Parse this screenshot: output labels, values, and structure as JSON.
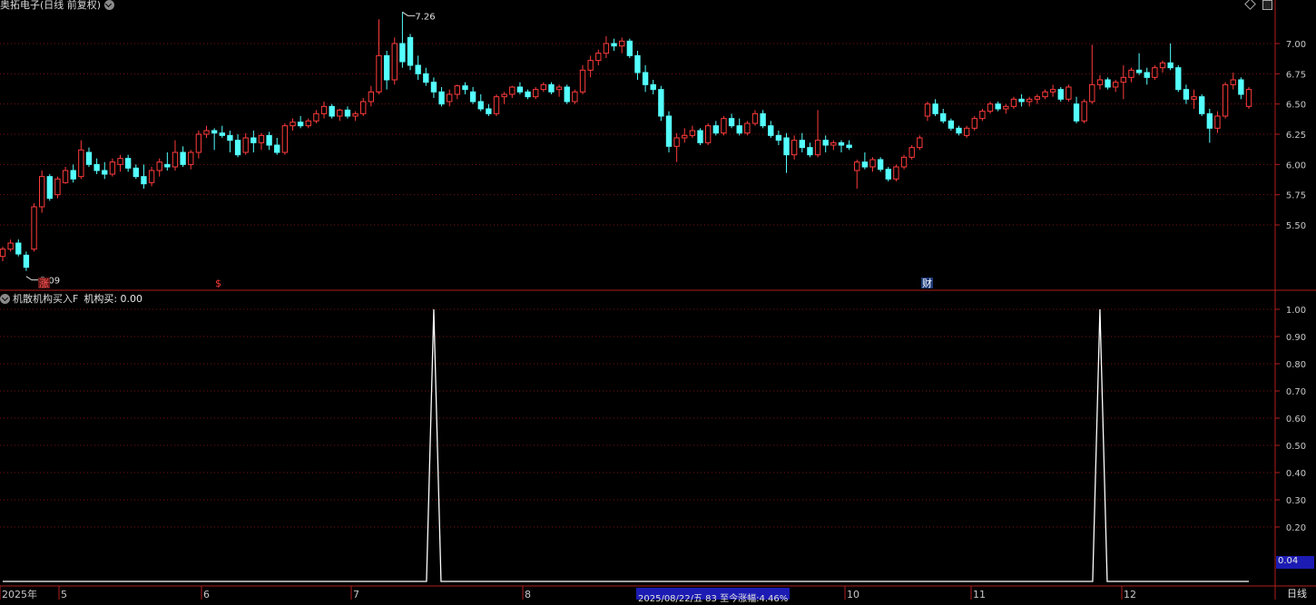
{
  "header": {
    "stock_title": "奥拓电子(日线 前复权)",
    "window_icons": [
      "diamond-icon",
      "scroll-up-icon"
    ]
  },
  "colors": {
    "up": "#ff3b3b",
    "down": "#54ffff",
    "frame": "#b01e1e",
    "grid": "#7a1212",
    "tick_text": "#c8c8c8",
    "indicator_line": "#ffffff",
    "highlight_bg": "#1c1cb4"
  },
  "price_chart": {
    "high_marker": "7.26",
    "low_marker": "5.09",
    "event_markers": [
      "涨",
      "$",
      "财"
    ]
  },
  "indicator": {
    "name": "机散机构买入F",
    "label": "机构买: 0.00",
    "current_value_box": "0.04"
  },
  "bottom_bar": {
    "status_text": "2025/08/22/五 83 至今涨幅:4.46%",
    "period_label": "日线",
    "month_labels": [
      "2025年",
      "5",
      "6",
      "7",
      "8",
      "10",
      "11",
      "12"
    ]
  },
  "chart_data": [
    {
      "type": "candlestick",
      "title": "奥拓电子(日线 前复权)",
      "y_ticks": [
        "7.00",
        "6.75",
        "6.50",
        "6.25",
        "6.00",
        "5.75",
        "5.50"
      ],
      "ylim": [
        4.9,
        7.45
      ],
      "grid": true,
      "annotations": [
        {
          "text": "7.26",
          "kind": "period-high"
        },
        {
          "text": "5.09",
          "kind": "period-low"
        }
      ],
      "ohlc_approx": [
        [
          5.24,
          5.32,
          5.2,
          5.3
        ],
        [
          5.3,
          5.38,
          5.28,
          5.35
        ],
        [
          5.35,
          5.38,
          5.24,
          5.26
        ],
        [
          5.25,
          5.28,
          5.12,
          5.15
        ],
        [
          5.3,
          5.68,
          5.28,
          5.65
        ],
        [
          5.65,
          5.95,
          5.6,
          5.9
        ],
        [
          5.9,
          5.92,
          5.7,
          5.72
        ],
        [
          5.75,
          5.9,
          5.72,
          5.88
        ],
        [
          5.85,
          5.98,
          5.84,
          5.95
        ],
        [
          5.95,
          6.0,
          5.85,
          5.88
        ],
        [
          5.9,
          6.2,
          5.88,
          6.12
        ],
        [
          6.1,
          6.14,
          5.98,
          6.0
        ],
        [
          6.0,
          6.05,
          5.92,
          5.95
        ],
        [
          5.95,
          6.02,
          5.88,
          5.92
        ],
        [
          5.92,
          6.05,
          5.9,
          6.02
        ],
        [
          6.0,
          6.08,
          5.94,
          6.05
        ],
        [
          6.05,
          6.08,
          5.94,
          5.97
        ],
        [
          5.97,
          6.0,
          5.88,
          5.9
        ],
        [
          5.9,
          6.0,
          5.8,
          5.84
        ],
        [
          5.85,
          5.98,
          5.82,
          5.95
        ],
        [
          5.95,
          6.05,
          5.9,
          6.02
        ],
        [
          6.0,
          6.1,
          5.95,
          5.98
        ],
        [
          5.98,
          6.2,
          5.95,
          6.1
        ],
        [
          6.1,
          6.15,
          5.98,
          6.0
        ],
        [
          6.0,
          6.12,
          5.96,
          6.1
        ],
        [
          6.1,
          6.28,
          6.05,
          6.25
        ],
        [
          6.25,
          6.32,
          6.22,
          6.28
        ],
        [
          6.28,
          6.3,
          6.12,
          6.26
        ],
        [
          6.26,
          6.32,
          6.22,
          6.24
        ],
        [
          6.24,
          6.28,
          6.1,
          6.2
        ],
        [
          6.2,
          6.25,
          6.06,
          6.08
        ],
        [
          6.1,
          6.26,
          6.08,
          6.22
        ],
        [
          6.22,
          6.28,
          6.1,
          6.18
        ],
        [
          6.18,
          6.26,
          6.12,
          6.24
        ],
        [
          6.24,
          6.27,
          6.12,
          6.16
        ],
        [
          6.16,
          6.22,
          6.08,
          6.1
        ],
        [
          6.1,
          6.34,
          6.08,
          6.32
        ],
        [
          6.32,
          6.38,
          6.28,
          6.35
        ],
        [
          6.35,
          6.4,
          6.3,
          6.32
        ],
        [
          6.32,
          6.38,
          6.3,
          6.36
        ],
        [
          6.36,
          6.45,
          6.34,
          6.42
        ],
        [
          6.42,
          6.52,
          6.38,
          6.48
        ],
        [
          6.48,
          6.5,
          6.38,
          6.4
        ],
        [
          6.4,
          6.46,
          6.36,
          6.45
        ],
        [
          6.45,
          6.48,
          6.38,
          6.4
        ],
        [
          6.4,
          6.44,
          6.36,
          6.42
        ],
        [
          6.42,
          6.55,
          6.4,
          6.52
        ],
        [
          6.52,
          6.65,
          6.48,
          6.6
        ],
        [
          6.6,
          7.2,
          6.58,
          6.9
        ],
        [
          6.9,
          6.94,
          6.62,
          6.7
        ],
        [
          6.7,
          7.05,
          6.66,
          7.0
        ],
        [
          7.0,
          7.26,
          6.8,
          6.85
        ],
        [
          7.05,
          7.08,
          6.78,
          6.82
        ],
        [
          6.82,
          6.9,
          6.7,
          6.75
        ],
        [
          6.75,
          6.8,
          6.65,
          6.68
        ],
        [
          6.68,
          6.72,
          6.55,
          6.6
        ],
        [
          6.6,
          6.64,
          6.48,
          6.5
        ],
        [
          6.52,
          6.62,
          6.48,
          6.58
        ],
        [
          6.58,
          6.66,
          6.54,
          6.65
        ],
        [
          6.65,
          6.68,
          6.58,
          6.62
        ],
        [
          6.6,
          6.64,
          6.5,
          6.52
        ],
        [
          6.52,
          6.58,
          6.44,
          6.46
        ],
        [
          6.46,
          6.5,
          6.4,
          6.42
        ],
        [
          6.42,
          6.58,
          6.4,
          6.56
        ],
        [
          6.56,
          6.6,
          6.5,
          6.58
        ],
        [
          6.58,
          6.65,
          6.55,
          6.64
        ],
        [
          6.64,
          6.68,
          6.58,
          6.6
        ],
        [
          6.6,
          6.62,
          6.54,
          6.56
        ],
        [
          6.56,
          6.64,
          6.54,
          6.62
        ],
        [
          6.62,
          6.68,
          6.6,
          6.66
        ],
        [
          6.66,
          6.68,
          6.58,
          6.6
        ],
        [
          6.62,
          6.66,
          6.56,
          6.64
        ],
        [
          6.64,
          6.66,
          6.5,
          6.52
        ],
        [
          6.52,
          6.62,
          6.5,
          6.6
        ],
        [
          6.6,
          6.82,
          6.58,
          6.78
        ],
        [
          6.78,
          6.9,
          6.72,
          6.86
        ],
        [
          6.86,
          6.95,
          6.82,
          6.92
        ],
        [
          6.92,
          7.06,
          6.88,
          7.0
        ],
        [
          7.0,
          7.04,
          6.94,
          6.98
        ],
        [
          6.98,
          7.05,
          6.92,
          7.02
        ],
        [
          7.02,
          7.04,
          6.88,
          6.9
        ],
        [
          6.9,
          6.94,
          6.7,
          6.76
        ],
        [
          6.76,
          6.82,
          6.6,
          6.66
        ],
        [
          6.66,
          6.7,
          6.58,
          6.62
        ],
        [
          6.62,
          6.65,
          6.36,
          6.4
        ],
        [
          6.4,
          6.44,
          6.1,
          6.15
        ],
        [
          6.15,
          6.26,
          6.02,
          6.22
        ],
        [
          6.22,
          6.3,
          6.18,
          6.24
        ],
        [
          6.24,
          6.32,
          6.22,
          6.28
        ],
        [
          6.28,
          6.3,
          6.16,
          6.18
        ],
        [
          6.18,
          6.34,
          6.16,
          6.32
        ],
        [
          6.32,
          6.36,
          6.24,
          6.26
        ],
        [
          6.26,
          6.4,
          6.24,
          6.38
        ],
        [
          6.38,
          6.42,
          6.3,
          6.32
        ],
        [
          6.32,
          6.38,
          6.24,
          6.26
        ],
        [
          6.26,
          6.36,
          6.24,
          6.34
        ],
        [
          6.34,
          6.45,
          6.32,
          6.42
        ],
        [
          6.42,
          6.45,
          6.3,
          6.32
        ],
        [
          6.32,
          6.36,
          6.22,
          6.24
        ],
        [
          6.24,
          6.28,
          6.16,
          6.2
        ],
        [
          6.22,
          6.26,
          5.93,
          6.08
        ],
        [
          6.08,
          6.24,
          6.04,
          6.2
        ],
        [
          6.2,
          6.26,
          6.1,
          6.14
        ],
        [
          6.14,
          6.18,
          6.06,
          6.08
        ],
        [
          6.08,
          6.45,
          6.06,
          6.2
        ],
        [
          6.2,
          6.24,
          6.1,
          6.16
        ],
        [
          6.16,
          6.2,
          6.12,
          6.18
        ],
        [
          6.18,
          6.2,
          6.1,
          6.16
        ],
        [
          6.16,
          6.2,
          6.12,
          6.14
        ],
        [
          5.95,
          6.04,
          5.8,
          6.02
        ],
        [
          6.02,
          6.1,
          5.96,
          5.98
        ],
        [
          5.98,
          6.06,
          5.94,
          6.04
        ],
        [
          6.04,
          6.06,
          5.94,
          5.96
        ],
        [
          5.96,
          5.98,
          5.86,
          5.88
        ],
        [
          5.88,
          6.0,
          5.86,
          5.98
        ],
        [
          5.98,
          6.08,
          5.96,
          6.06
        ],
        [
          6.06,
          6.16,
          6.04,
          6.14
        ],
        [
          6.14,
          6.24,
          6.12,
          6.22
        ],
        [
          6.4,
          6.52,
          6.36,
          6.5
        ],
        [
          6.5,
          6.54,
          6.4,
          6.42
        ],
        [
          6.42,
          6.46,
          6.34,
          6.36
        ],
        [
          6.36,
          6.38,
          6.28,
          6.3
        ],
        [
          6.3,
          6.32,
          6.24,
          6.26
        ],
        [
          6.24,
          6.32,
          6.22,
          6.3
        ],
        [
          6.3,
          6.4,
          6.28,
          6.38
        ],
        [
          6.38,
          6.46,
          6.36,
          6.44
        ],
        [
          6.44,
          6.52,
          6.42,
          6.5
        ],
        [
          6.5,
          6.52,
          6.44,
          6.46
        ],
        [
          6.46,
          6.5,
          6.42,
          6.48
        ],
        [
          6.48,
          6.56,
          6.46,
          6.54
        ],
        [
          6.54,
          6.58,
          6.48,
          6.52
        ],
        [
          6.52,
          6.56,
          6.48,
          6.54
        ],
        [
          6.54,
          6.58,
          6.5,
          6.56
        ],
        [
          6.56,
          6.62,
          6.54,
          6.6
        ],
        [
          6.6,
          6.66,
          6.56,
          6.62
        ],
        [
          6.62,
          6.64,
          6.52,
          6.54
        ],
        [
          6.54,
          6.66,
          6.52,
          6.64
        ],
        [
          6.5,
          6.56,
          6.34,
          6.36
        ],
        [
          6.36,
          6.54,
          6.34,
          6.52
        ],
        [
          6.52,
          6.99,
          6.5,
          6.66
        ],
        [
          6.66,
          6.74,
          6.62,
          6.7
        ],
        [
          6.7,
          6.72,
          6.62,
          6.64
        ],
        [
          6.64,
          6.7,
          6.6,
          6.68
        ],
        [
          6.68,
          6.82,
          6.54,
          6.72
        ],
        [
          6.72,
          6.8,
          6.68,
          6.78
        ],
        [
          6.78,
          6.92,
          6.74,
          6.76
        ],
        [
          6.76,
          6.8,
          6.66,
          6.72
        ],
        [
          6.72,
          6.82,
          6.7,
          6.8
        ],
        [
          6.8,
          6.86,
          6.76,
          6.84
        ],
        [
          6.84,
          7.0,
          6.78,
          6.8
        ],
        [
          6.8,
          6.82,
          6.6,
          6.62
        ],
        [
          6.62,
          6.66,
          6.5,
          6.54
        ],
        [
          6.54,
          6.62,
          6.46,
          6.56
        ],
        [
          6.56,
          6.58,
          6.4,
          6.42
        ],
        [
          6.42,
          6.46,
          6.18,
          6.3
        ],
        [
          6.3,
          6.44,
          6.26,
          6.4
        ],
        [
          6.4,
          6.68,
          6.38,
          6.66
        ],
        [
          6.66,
          6.76,
          6.62,
          6.7
        ],
        [
          6.7,
          6.72,
          6.54,
          6.58
        ],
        [
          6.48,
          6.64,
          6.46,
          6.62
        ]
      ]
    },
    {
      "type": "line",
      "title": "机散机构买入F",
      "series": [
        {
          "name": "机构买",
          "spikes_at_bar": [
            55,
            140
          ],
          "baseline": 0,
          "spike_value": 1.0
        }
      ],
      "y_ticks": [
        "1.00",
        "0.90",
        "0.80",
        "0.70",
        "0.60",
        "0.50",
        "0.40",
        "0.30",
        "0.20"
      ],
      "ylim": [
        0,
        1.0
      ]
    }
  ]
}
